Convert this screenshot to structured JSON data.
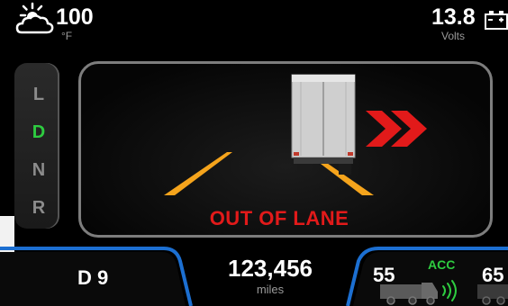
{
  "status_bar": {
    "temperature": {
      "value": "100",
      "unit": "°F",
      "icon": "sun-behind-cloud-icon"
    },
    "voltage": {
      "value": "13.8",
      "unit": "Volts",
      "icon": "battery-icon"
    }
  },
  "gear_selector": {
    "gears": [
      {
        "label": "L",
        "active": false
      },
      {
        "label": "D",
        "active": true
      },
      {
        "label": "N",
        "active": false
      },
      {
        "label": "R",
        "active": false
      }
    ]
  },
  "lane_alert": {
    "message": "OUT OF LANE",
    "direction_icon": "double-chevron-right-icon",
    "colors": {
      "alert": "#e21a1a",
      "lane": "#f5a41c",
      "active_gear": "#2ecc40"
    }
  },
  "bottom_bar": {
    "gear_readout": "D 9",
    "odometer": {
      "value": "123,456",
      "unit": "miles"
    },
    "cruise": {
      "set_speed": "55",
      "label": "ACC",
      "lead_speed": "65",
      "icon": "truck-radar-icon"
    }
  }
}
